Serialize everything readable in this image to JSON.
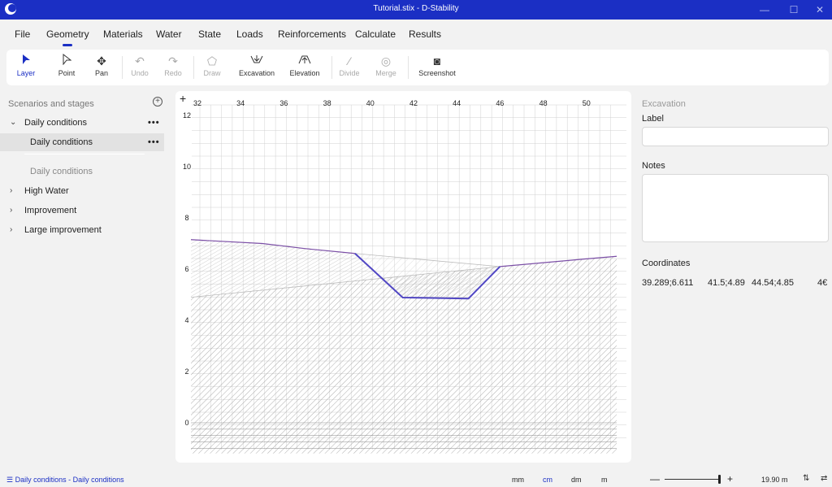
{
  "window": {
    "title": "Tutorial.stix - D-Stability",
    "min": "—",
    "max": "☐",
    "close": "✕"
  },
  "menu": [
    "File",
    "Geometry",
    "Materials",
    "Water",
    "State",
    "Loads",
    "Reinforcements",
    "Calculate",
    "Results"
  ],
  "toolbar": {
    "layer": "Layer",
    "point": "Point",
    "pan": "Pan",
    "undo": "Undo",
    "redo": "Redo",
    "draw": "Draw",
    "excavation": "Excavation",
    "elevation": "Elevation",
    "divide": "Divide",
    "merge": "Merge",
    "screenshot": "Screenshot"
  },
  "left_panel": {
    "header": "Scenarios and stages",
    "add_symbol": "+",
    "dots": "•••",
    "items": [
      {
        "label": "Daily conditions",
        "chevron": "⌄"
      },
      {
        "label": "Daily conditions"
      },
      {
        "label": "Daily conditions"
      },
      {
        "label": "High Water",
        "chevron": "›"
      },
      {
        "label": "Improvement",
        "chevron": "›"
      },
      {
        "label": "Large improvement",
        "chevron": "›"
      }
    ]
  },
  "canvas": {
    "corner_symbol": "+",
    "x_ticks": [
      "32",
      "34",
      "36",
      "38",
      "40",
      "42",
      "44",
      "46",
      "48",
      "50"
    ],
    "y_ticks": [
      "12",
      "10",
      "8",
      "6",
      "4",
      "2",
      "0"
    ],
    "colors": {
      "boundary": "#7b4fa6",
      "excavation": "#5147c4",
      "grid": "#d0d0d0",
      "hatch": "#9a9a9a"
    }
  },
  "right_panel": {
    "section": "Excavation",
    "label_field": "Label",
    "label_value": "",
    "notes_field": "Notes",
    "notes_value": "",
    "coordinates_label": "Coordinates",
    "coordinates": [
      "39.289;6.611",
      "41.5;4.89",
      "44.54;4.85",
      "4€"
    ]
  },
  "status": {
    "breadcrumb": "Daily conditions - Daily conditions",
    "units": [
      "mm",
      "cm",
      "dm",
      "m"
    ],
    "active_unit": "cm",
    "zoom_minus": "—",
    "zoom_plus": "+",
    "zoom_value": "19.90 m",
    "sort_icon": "⇅",
    "swap_icon": "⇄"
  }
}
